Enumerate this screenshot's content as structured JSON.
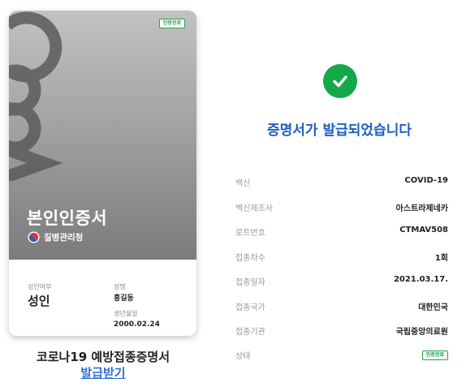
{
  "card": {
    "verified_badge": "인증완료",
    "title": "본인인증서",
    "issuer": "질병관리청",
    "adult_label": "성인여부",
    "adult_value": "성인",
    "name_label": "성명",
    "name_value": "홍길동",
    "birth_label": "생년월일",
    "birth_value": "2000.02.24"
  },
  "certificate_name": "코로나19 예방접종증명서",
  "issue_link": "발급받기",
  "success_message": "증명서가 발급되었습니다",
  "details": [
    {
      "label": "백신",
      "value": "COVID-19"
    },
    {
      "label": "백신제조사",
      "value": "아스트라제네카"
    },
    {
      "label": "로트번호",
      "value": "CTMAV508"
    },
    {
      "label": "접종차수",
      "value": "1회"
    },
    {
      "label": "접종일자",
      "value": "2021.03.17."
    },
    {
      "label": "접종국가",
      "value": "대한민국"
    },
    {
      "label": "접종기관",
      "value": "국립중앙의료원"
    },
    {
      "label": "상태",
      "value": "인증완료"
    }
  ],
  "colors": {
    "success_green": "#14a84b",
    "title_blue": "#1e5fbf",
    "link_blue": "#2f6fd6",
    "badge_green": "#2aa24a"
  },
  "icons": {
    "logo": "coov-logo",
    "issuer": "kdca-emblem-icon",
    "success": "check-circle-icon"
  }
}
